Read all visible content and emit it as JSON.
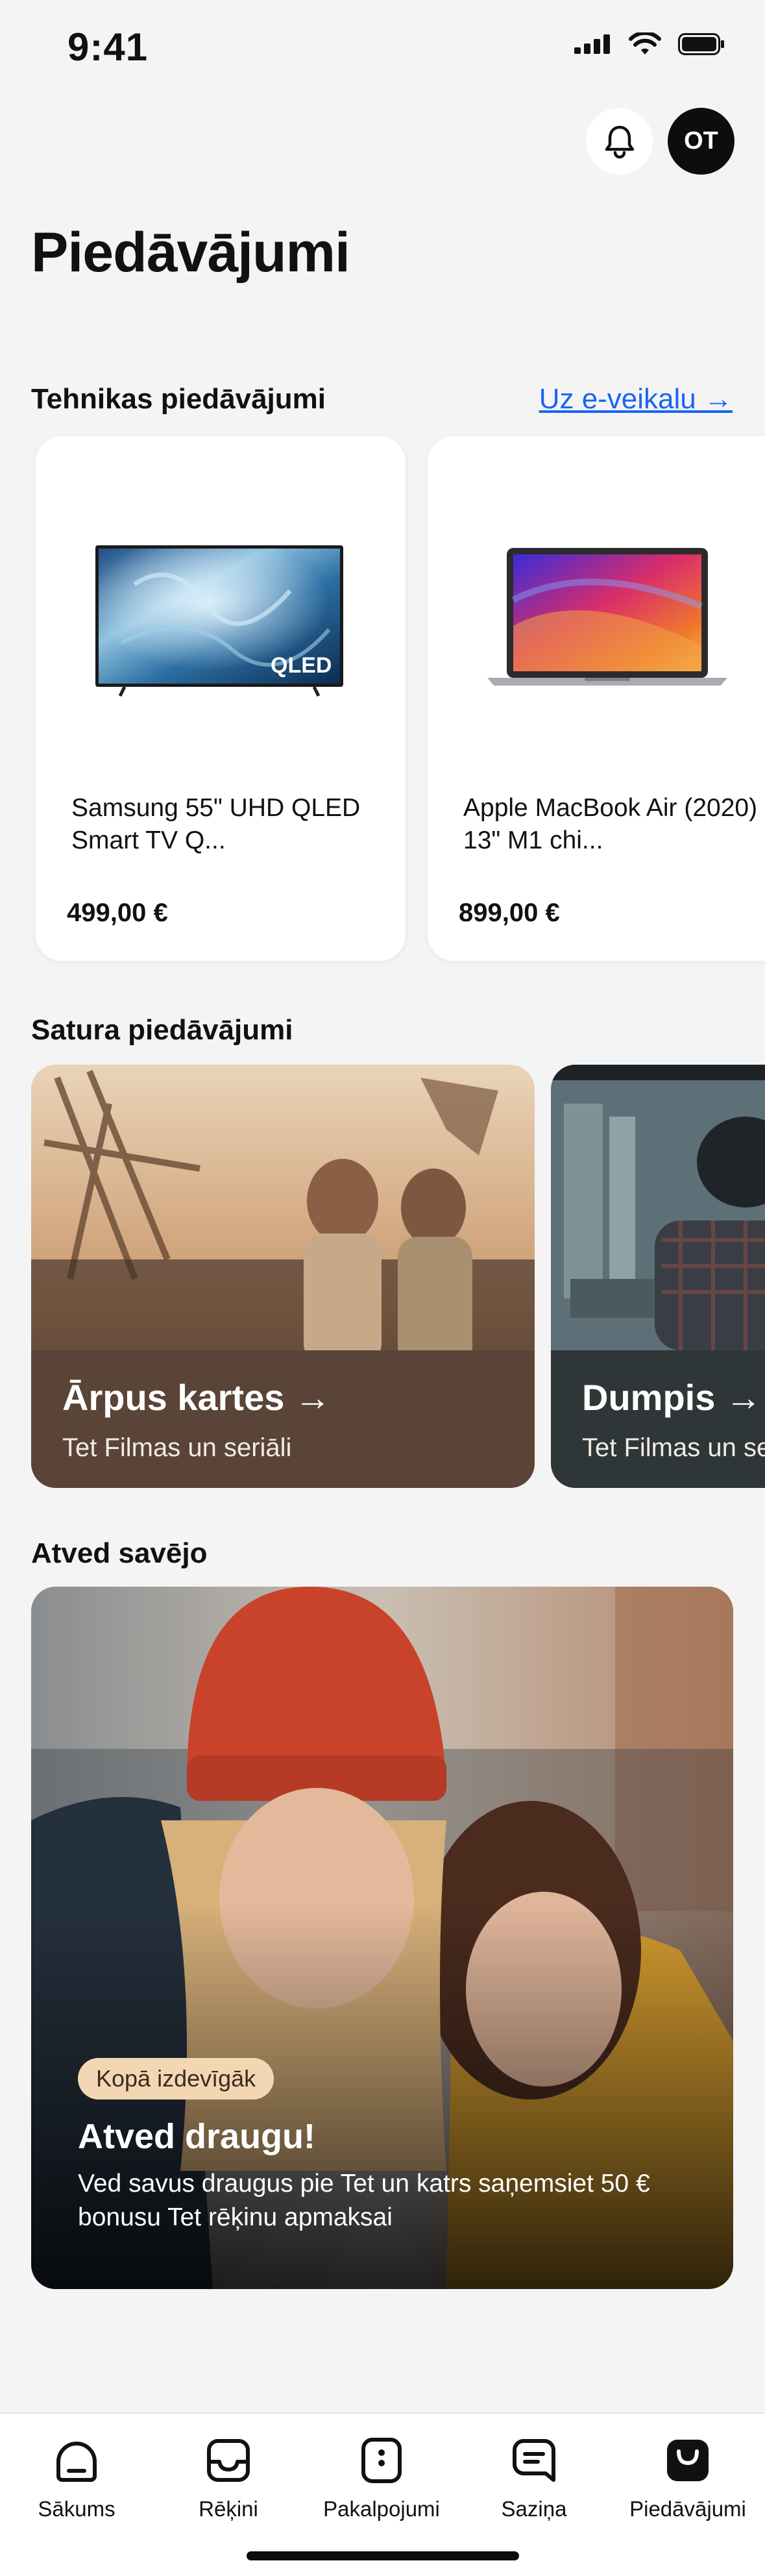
{
  "status_bar": {
    "time": "9:41"
  },
  "header": {
    "notifications_icon": "bell-icon",
    "avatar_initials": "OT"
  },
  "page_title": "Piedāvājumi",
  "tech_section": {
    "title": "Tehnikas piedāvājumi",
    "link": "Uz e-veikalu →",
    "products": [
      {
        "name": "Samsung 55\" UHD QLED Smart TV Q...",
        "price": "499,00 €",
        "image_icon": "tv-image",
        "image_badge": "QLED"
      },
      {
        "name": "Apple MacBook Air (2020) 13\" M1 chi...",
        "price": "899,00 €",
        "image_icon": "laptop-image"
      }
    ]
  },
  "content_section": {
    "title": "Satura piedāvājumi",
    "cards": [
      {
        "title": "Ārpus kartes →",
        "subtitle": "Tet Filmas un seriāli"
      },
      {
        "title": "Dumpis →",
        "subtitle": "Tet Filmas un seriāli"
      }
    ]
  },
  "referral_section": {
    "title": "Atved savējo",
    "badge": "Kopā izdevīgāk",
    "headline": "Atved draugu!",
    "text": "Ved savus draugus pie Tet un katrs saņemsiet 50 € bonusu Tet rēķinu apmaksai"
  },
  "tabbar": {
    "items": [
      {
        "label": "Sākums",
        "icon": "home-icon"
      },
      {
        "label": "Rēķini",
        "icon": "inbox-icon"
      },
      {
        "label": "Pakalpojumi",
        "icon": "services-icon"
      },
      {
        "label": "Saziņa",
        "icon": "chat-icon"
      },
      {
        "label": "Piedāvājumi",
        "icon": "offers-bag-icon"
      }
    ],
    "active_index": 4
  },
  "colors": {
    "link": "#1b64f2",
    "badge_bg": "#f3d7b4",
    "background": "#f4f4f5"
  }
}
